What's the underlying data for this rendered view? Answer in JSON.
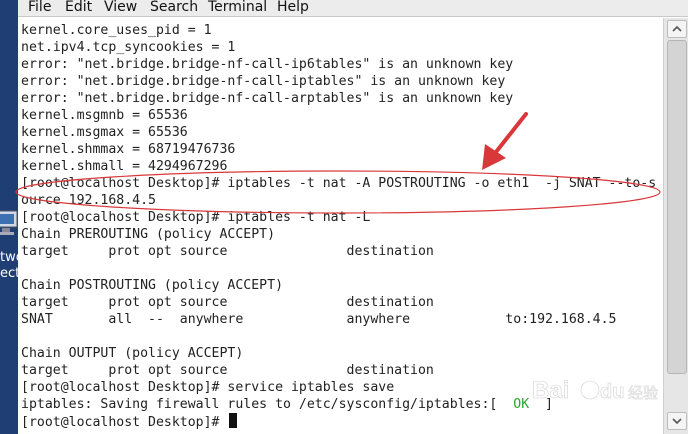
{
  "menubar": [
    "File",
    "Edit",
    "View",
    "Search",
    "Terminal",
    "Help"
  ],
  "desktop": {
    "label_1": "two",
    "label_2": "ect"
  },
  "terminal": {
    "lines": [
      "kernel.core_uses_pid = 1",
      "net.ipv4.tcp_syncookies = 1",
      "error: \"net.bridge.bridge-nf-call-ip6tables\" is an unknown key",
      "error: \"net.bridge.bridge-nf-call-iptables\" is an unknown key",
      "error: \"net.bridge.bridge-nf-call-arptables\" is an unknown key",
      "kernel.msgmnb = 65536",
      "kernel.msgmax = 65536",
      "kernel.shmmax = 68719476736",
      "kernel.shmall = 4294967296",
      "[root@localhost Desktop]# iptables -t nat -A POSTROUTING -o eth1  -j SNAT --to-s",
      "ource 192.168.4.5",
      "[root@localhost Desktop]# iptables -t nat -L",
      "Chain PREROUTING (policy ACCEPT)",
      "target     prot opt source               destination",
      "",
      "Chain POSTROUTING (policy ACCEPT)",
      "target     prot opt source               destination",
      "SNAT       all  --  anywhere             anywhere            to:192.168.4.5",
      "",
      "Chain OUTPUT (policy ACCEPT)",
      "target     prot opt source               destination",
      "[root@localhost Desktop]# service iptables save"
    ],
    "save_line_prefix": "iptables: Saving firewall rules to /etc/sysconfig/iptables:[  ",
    "save_line_ok": "OK",
    "save_line_suffix": "  ]",
    "prompt": "[root@localhost Desktop]# "
  },
  "annotation": {
    "color": "#d9383a"
  },
  "watermark": {
    "brand": "Bai",
    "brand2": "du",
    "sub": "经验"
  }
}
